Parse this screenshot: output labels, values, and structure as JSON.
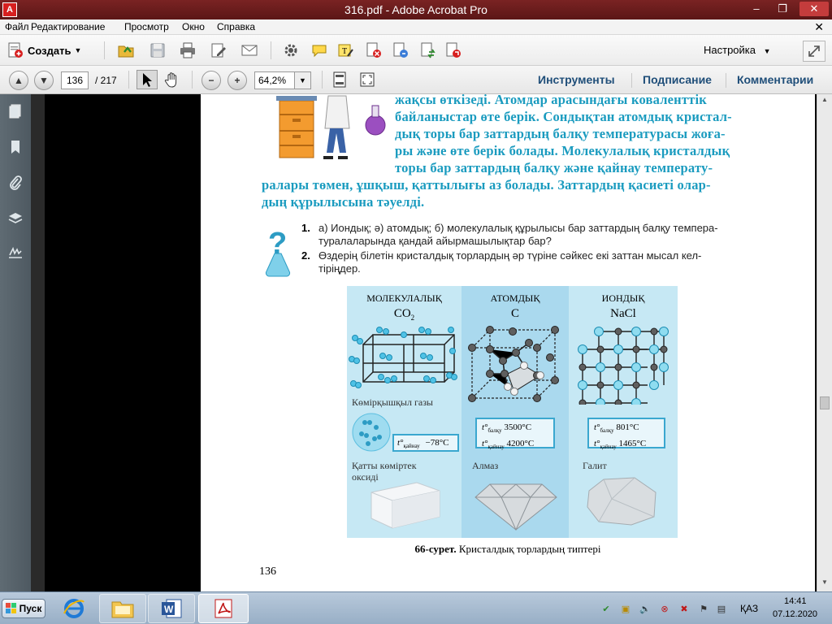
{
  "window": {
    "title": "316.pdf - Adobe Acrobat Pro",
    "app_icon": "acrobat-icon",
    "minimize": "–",
    "restore": "❐",
    "close": "✕"
  },
  "menu": {
    "items": [
      "Файл",
      "Редактирование",
      "Просмотр",
      "Окно",
      "Справка"
    ],
    "close_doc": "✕"
  },
  "toolbar": {
    "create_label": "Создать",
    "settings_label": "Настройка",
    "icons": [
      "open-folder-icon",
      "save-icon",
      "print-icon",
      "edit-icon",
      "email-icon",
      "gear-icon",
      "comment-icon",
      "highlight-icon",
      "page-delete-icon",
      "page-extract-icon",
      "page-replace-icon",
      "page-rotate-icon"
    ]
  },
  "navigation": {
    "current_page": "136",
    "total_pages": "/ 217",
    "zoom": "64,2%",
    "tools_label": "Инструменты",
    "sign_label": "Подписание",
    "comment_label": "Комментарии"
  },
  "document": {
    "paragraph_lines": [
      "жақсы өткізеді. Атомдар арасындағы коваленттік",
      "байланыстар өте берік. Сондықтан атомдық кристал-",
      "дық торы бар заттардың балқу температурасы жоға-",
      "ры және өте берік болады. Молекулалық кристалдық",
      "торы бар заттардың балқу және қайнау температу-",
      "ралары төмен, ұшқыш, қаттылығы аз болады. Заттардың қасиеті олар-",
      "дың құрылысына тәуелді."
    ],
    "questions": [
      {
        "num": "1.",
        "lines": [
          "а) Иондық; ә) атомдық; б) молекулалық құрылысы бар заттардың балқу темпера-",
          "туралаларында қандай айырмашылықтар бар?"
        ]
      },
      {
        "num": "2.",
        "lines": [
          "Өздерің білетін кристалдық торлардың әр түріне сәйкес екі заттан мысал кел-",
          "тіріңдер."
        ]
      }
    ],
    "figure": {
      "columns": [
        {
          "head": "МОЛЕКУЛАЛЫҚ",
          "formula": "CO",
          "formula_sub": "2",
          "substance": "Көмірқышқыл газы",
          "props": [
            {
              "label": "t°",
              "sub": "қайнау",
              "value": "−78°C"
            }
          ],
          "example": "Қатты көміртек оксиді"
        },
        {
          "head": "АТОМДЫҚ",
          "formula": "C",
          "formula_sub": "",
          "substance": "",
          "props": [
            {
              "label": "t°",
              "sub": "балқу",
              "value": "3500°C"
            },
            {
              "label": "t°",
              "sub": "қайнау",
              "value": "4200°C"
            }
          ],
          "example": "Алмаз"
        },
        {
          "head": "ИОНДЫҚ",
          "formula": "NaCl",
          "formula_sub": "",
          "substance": "",
          "props": [
            {
              "label": "t°",
              "sub": "балқу",
              "value": "801°C"
            },
            {
              "label": "t°",
              "sub": "қайнау",
              "value": "1465°C"
            }
          ],
          "example": "Галит"
        }
      ],
      "caption_bold": "66-сурет.",
      "caption_text": " Кристалдық торлардың типтері"
    },
    "page_number": "136"
  },
  "taskbar": {
    "start_label": "Пуск",
    "language": "ҚАЗ",
    "time": "14:41",
    "date": "07.12.2020"
  },
  "colors": {
    "title_bar": "#6b1d1d",
    "teal_text": "#1a9bbf",
    "pane_link": "#1f4e79",
    "figure_bg": "#c6e8f4"
  }
}
